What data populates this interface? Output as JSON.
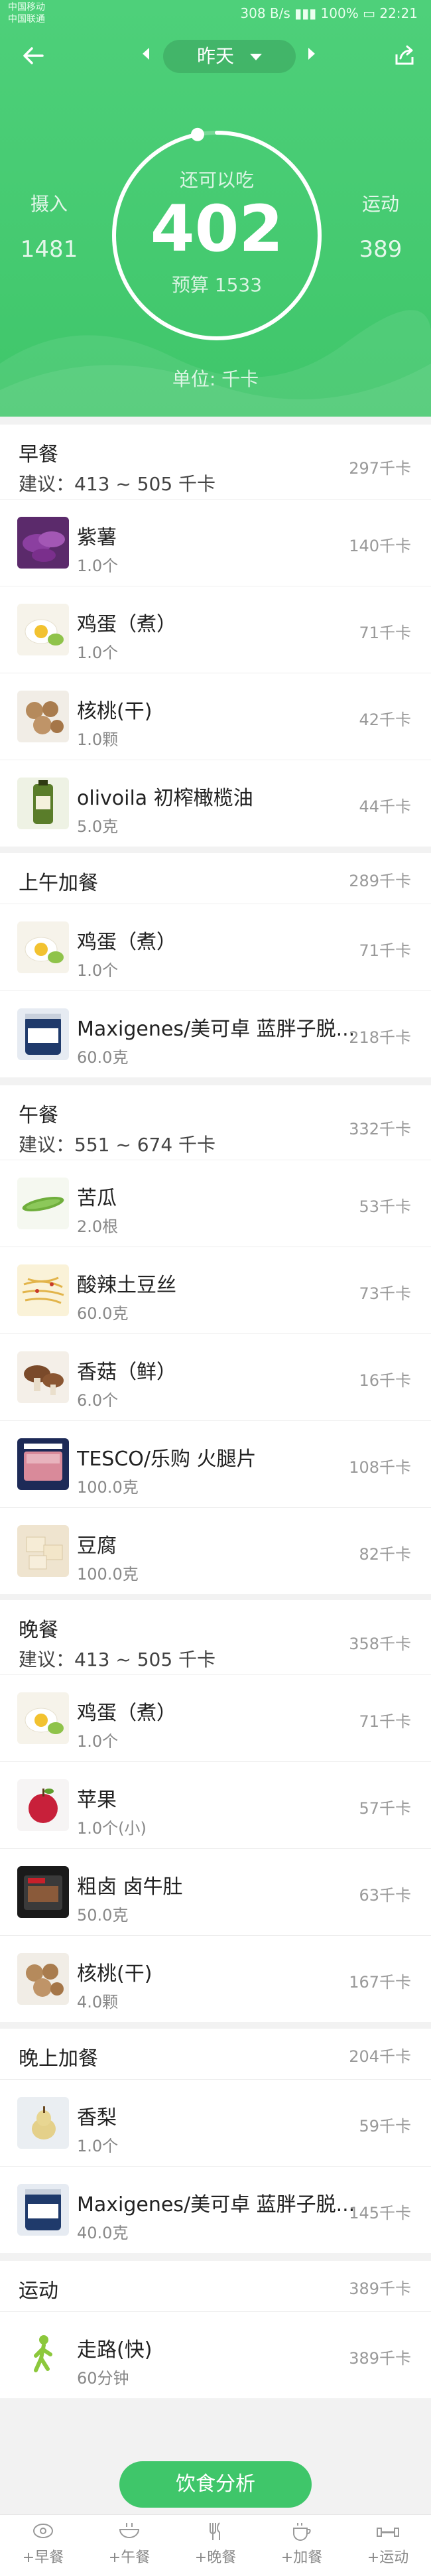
{
  "status": {
    "carrier1": "中国移动",
    "carrier2": "中国联通",
    "speed": "308 B/s",
    "battery": "100%",
    "time": "22:21"
  },
  "nav": {
    "day": "昨天"
  },
  "summary": {
    "remaining_label": "还可以吃",
    "remaining": "402",
    "budget": "预算 1533",
    "intake_label": "摄入",
    "intake": "1481",
    "exercise_label": "运动",
    "exercise": "389",
    "unit": "单位: 千卡",
    "ring_progress": 0.97
  },
  "sections": [
    {
      "title": "早餐",
      "advice": "建议：413 ~ 505 千卡",
      "kcal": "297千卡",
      "items": [
        {
          "name": "紫薯",
          "qty": "1.0个",
          "kcal": "140千卡",
          "icon": "purple-sweet-potato"
        },
        {
          "name": "鸡蛋（煮）",
          "qty": "1.0个",
          "kcal": "71千卡",
          "icon": "boiled-egg"
        },
        {
          "name": "核桃(干)",
          "qty": "1.0颗",
          "kcal": "42千卡",
          "icon": "walnut"
        },
        {
          "name": "olivoila 初榨橄榄油",
          "qty": "5.0克",
          "kcal": "44千卡",
          "icon": "olive-oil"
        }
      ]
    },
    {
      "title": "上午加餐",
      "advice": "",
      "kcal": "289千卡",
      "items": [
        {
          "name": "鸡蛋（煮）",
          "qty": "1.0个",
          "kcal": "71千卡",
          "icon": "boiled-egg"
        },
        {
          "name": "Maxigenes/美可卓 蓝胖子脱...",
          "qty": "60.0克",
          "kcal": "218千卡",
          "icon": "milk-powder"
        }
      ]
    },
    {
      "title": "午餐",
      "advice": "建议：551 ~ 674 千卡",
      "kcal": "332千卡",
      "items": [
        {
          "name": "苦瓜",
          "qty": "2.0根",
          "kcal": "53千卡",
          "icon": "bitter-melon"
        },
        {
          "name": "酸辣土豆丝",
          "qty": "60.0克",
          "kcal": "73千卡",
          "icon": "potato-shreds"
        },
        {
          "name": "香菇（鲜）",
          "qty": "6.0个",
          "kcal": "16千卡",
          "icon": "mushroom"
        },
        {
          "name": "TESCO/乐购 火腿片",
          "qty": "100.0克",
          "kcal": "108千卡",
          "icon": "ham"
        },
        {
          "name": "豆腐",
          "qty": "100.0克",
          "kcal": "82千卡",
          "icon": "tofu"
        }
      ]
    },
    {
      "title": "晚餐",
      "advice": "建议：413 ~ 505 千卡",
      "kcal": "358千卡",
      "items": [
        {
          "name": "鸡蛋（煮）",
          "qty": "1.0个",
          "kcal": "71千卡",
          "icon": "boiled-egg"
        },
        {
          "name": "苹果",
          "qty": "1.0个(小)",
          "kcal": "57千卡",
          "icon": "apple"
        },
        {
          "name": "粗卤 卤牛肚",
          "qty": "50.0克",
          "kcal": "63千卡",
          "icon": "beef-tripe"
        },
        {
          "name": "核桃(干)",
          "qty": "4.0颗",
          "kcal": "167千卡",
          "icon": "walnut"
        }
      ]
    },
    {
      "title": "晚上加餐",
      "advice": "",
      "kcal": "204千卡",
      "items": [
        {
          "name": "香梨",
          "qty": "1.0个",
          "kcal": "59千卡",
          "icon": "pear"
        },
        {
          "name": "Maxigenes/美可卓 蓝胖子脱...",
          "qty": "40.0克",
          "kcal": "145千卡",
          "icon": "milk-powder"
        }
      ]
    },
    {
      "title": "运动",
      "advice": "",
      "kcal": "389千卡",
      "items": [
        {
          "name": "走路(快)",
          "qty": "60分钟",
          "kcal": "389千卡",
          "icon": "walking"
        }
      ]
    }
  ],
  "analyze_label": "饮食分析",
  "tabs": [
    {
      "label": "+早餐",
      "icon": "breakfast-icon"
    },
    {
      "label": "+午餐",
      "icon": "lunch-icon"
    },
    {
      "label": "+晚餐",
      "icon": "dinner-icon"
    },
    {
      "label": "+加餐",
      "icon": "snack-icon"
    },
    {
      "label": "+运动",
      "icon": "exercise-icon"
    }
  ]
}
